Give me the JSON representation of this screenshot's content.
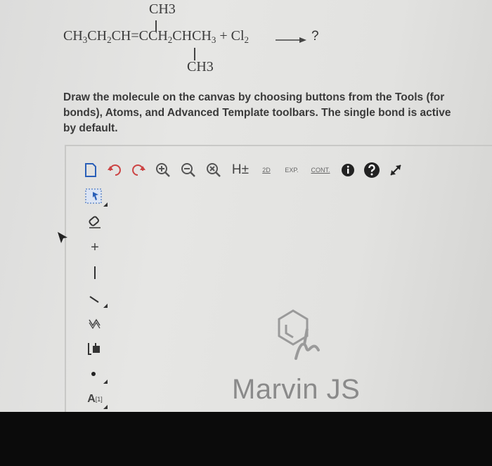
{
  "question": {
    "ch3_top": "CH3",
    "ch3_bottom": "CH3",
    "reactant_parts": [
      "CH",
      "3",
      "CH",
      "2",
      "CH=CCH",
      "2",
      "CHCH",
      "3",
      " + Cl",
      "2"
    ],
    "product": "?"
  },
  "instruction": "Draw the molecule on the canvas by choosing buttons from the Tools (for bonds), Atoms, and Advanced Template toolbars. The single bond is active by default.",
  "top_toolbar": {
    "buttons": [
      {
        "name": "new-document-icon"
      },
      {
        "name": "undo-icon"
      },
      {
        "name": "redo-icon"
      },
      {
        "name": "zoom-in-icon"
      },
      {
        "name": "zoom-out-icon"
      },
      {
        "name": "zoom-reset-icon"
      },
      {
        "name": "hydrogen-toggle",
        "label": "H±"
      },
      {
        "name": "clean-2d",
        "label": "2D"
      },
      {
        "name": "expand-group",
        "label": "EXP."
      },
      {
        "name": "contract-group",
        "label": "CONT."
      },
      {
        "name": "info-icon"
      },
      {
        "name": "help-icon"
      },
      {
        "name": "fullscreen-icon"
      }
    ]
  },
  "left_toolbar": {
    "buttons": [
      {
        "name": "select-tool"
      },
      {
        "name": "erase-tool"
      },
      {
        "name": "charge-tool",
        "label": "+"
      },
      {
        "name": "single-bond-tool"
      },
      {
        "name": "bond-type-tool"
      },
      {
        "name": "chain-tool"
      },
      {
        "name": "template-tool"
      },
      {
        "name": "radical-tool"
      },
      {
        "name": "atom-map-tool",
        "label": "A",
        "sup": "[1]"
      }
    ]
  },
  "canvas": {
    "brand": "Marvin JS"
  },
  "colors": {
    "background": "#e2e2e0",
    "accent": "#2a5fb8",
    "dark_icon": "#222222",
    "bottom_band": "#0b0b0b"
  }
}
